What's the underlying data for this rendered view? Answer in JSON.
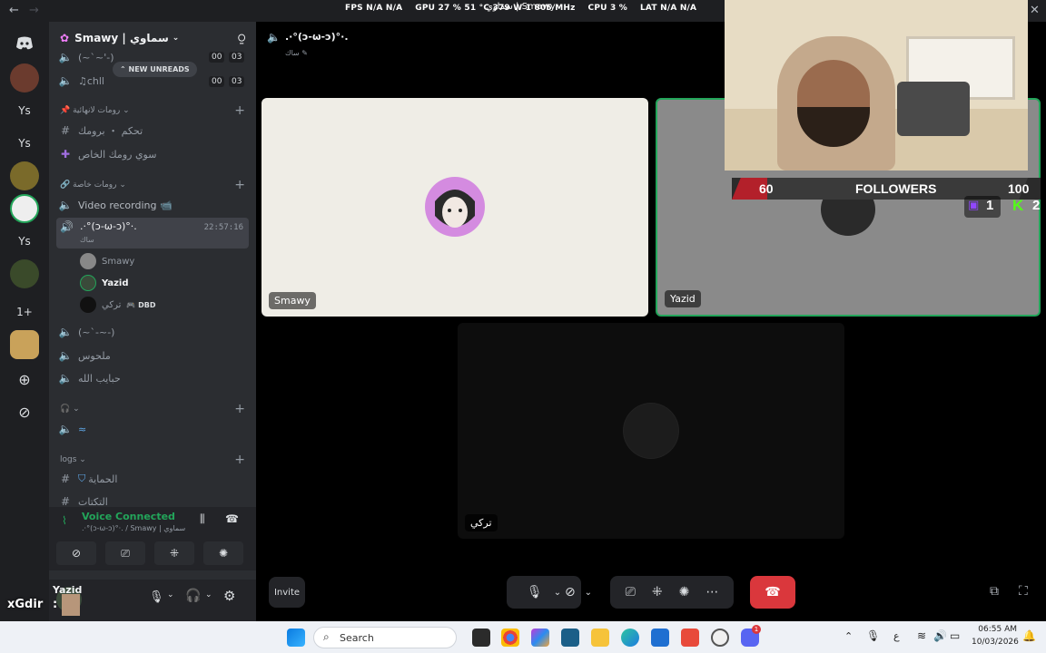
{
  "titlebar": {
    "back": "←",
    "forward": "→",
    "window_title": "سماوي | Smawy",
    "close": "✕"
  },
  "osd": {
    "fps_label": "FPS",
    "fps1": "N/A",
    "fps2": "N/A",
    "gpu_label": "GPU",
    "gpu_pct": "27 %",
    "gpu_temp": "51 °C",
    "gpu_w": "379 W",
    "gpu_clk": "1 805 MHz",
    "cpu_label": "CPU",
    "cpu_pct": "3 %",
    "lat_label": "LAT",
    "lat1": "N/A",
    "lat2": "N/A"
  },
  "guilds": {
    "ys": "Ys",
    "plus_one": "1+",
    "badge": "1"
  },
  "server": {
    "name": "Smawy | سماوي"
  },
  "channels": {
    "top1": "(~`~'-)",
    "top2": "♫chll",
    "count1a": "00",
    "count1b": "03",
    "count2a": "00",
    "count2b": "03",
    "new_unreads": "NEW UNREADS",
    "cat1": "رومات لانهائية",
    "c1": "تحكم ・ برومك",
    "c2": "سوي رومك الخاص",
    "cat2": "رومات خاصة",
    "c3": "Video recording 📹",
    "active": ".·°(ↄ-ω-ↄ)°·.",
    "active_sub": "ساك",
    "active_time": "22:57:16",
    "u1": "Smawy",
    "u2": "Yazid",
    "u3": "تركي",
    "u3_tag": "DBD",
    "c4": "(~`-~-)",
    "c5": "ملحوس",
    "c6": "حبايب الله",
    "c7": "",
    "cat3": "logs",
    "c8": "الحماية",
    "c9": "التكتات"
  },
  "voice": {
    "status": "Voice Connected",
    "channel": ".·°(ↄ-ω-ↄ)°·. / Smawy | سماوي"
  },
  "user": {
    "name": "Yazid",
    "overlay": "xGdir"
  },
  "stage": {
    "title": ".·°(ↄ-ω-ↄ)°·.",
    "subtitle": "ساك ✎"
  },
  "tiles": {
    "t1": "Smawy",
    "t2": "Yazid",
    "t3": "تركي"
  },
  "controls": {
    "invite": "Invite"
  },
  "overlay": {
    "left": "60",
    "label": "FOLLOWERS",
    "right": "100",
    "twitch": "1",
    "kick": "2"
  },
  "taskbar": {
    "search": "Search",
    "lang": "ع",
    "time": "06:55 AM",
    "date": "10/03/2026"
  },
  "colors": {
    "accent": "#23a55a",
    "danger": "#da373c",
    "brand": "#5865f2"
  }
}
